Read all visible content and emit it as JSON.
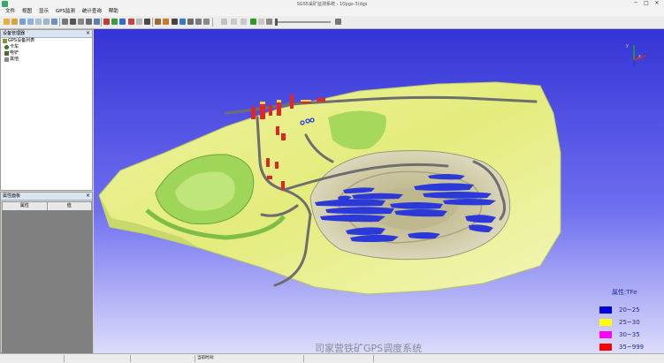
{
  "window": {
    "title": "SGS5采矿监测系统 - 1(Ipgs-3)dgs",
    "min": "─",
    "max": "□",
    "close": "✕"
  },
  "menu": [
    "文件",
    "视图",
    "显示",
    "GPS监测",
    "统计查询",
    "帮助"
  ],
  "device_panel": {
    "title": "设备管理器",
    "items": [
      {
        "label": "GPS设备列表"
      },
      {
        "label": "卡车"
      },
      {
        "label": "电铲"
      },
      {
        "label": "其他"
      }
    ]
  },
  "property_panel": {
    "title": "属性面板",
    "columns": [
      "属性",
      "值"
    ]
  },
  "legend": {
    "title": "属性:TFe",
    "entries": [
      {
        "label": "20~25",
        "color": "#0000d8"
      },
      {
        "label": "25~30",
        "color": "#ffff00"
      },
      {
        "label": "30~35",
        "color": "#ff00ff"
      },
      {
        "label": "35~999",
        "color": "#ff0000"
      }
    ]
  },
  "caption": "司家营铁矿GPS调度系统",
  "status": {
    "current_time_label": "当前时间:"
  },
  "colors": {
    "background": "#2d2de0",
    "terrain": "#e6ee88",
    "pit": "#c9c29a",
    "ore": "#2a39d8",
    "road": "#6e6e6e",
    "building": "#e12626"
  }
}
